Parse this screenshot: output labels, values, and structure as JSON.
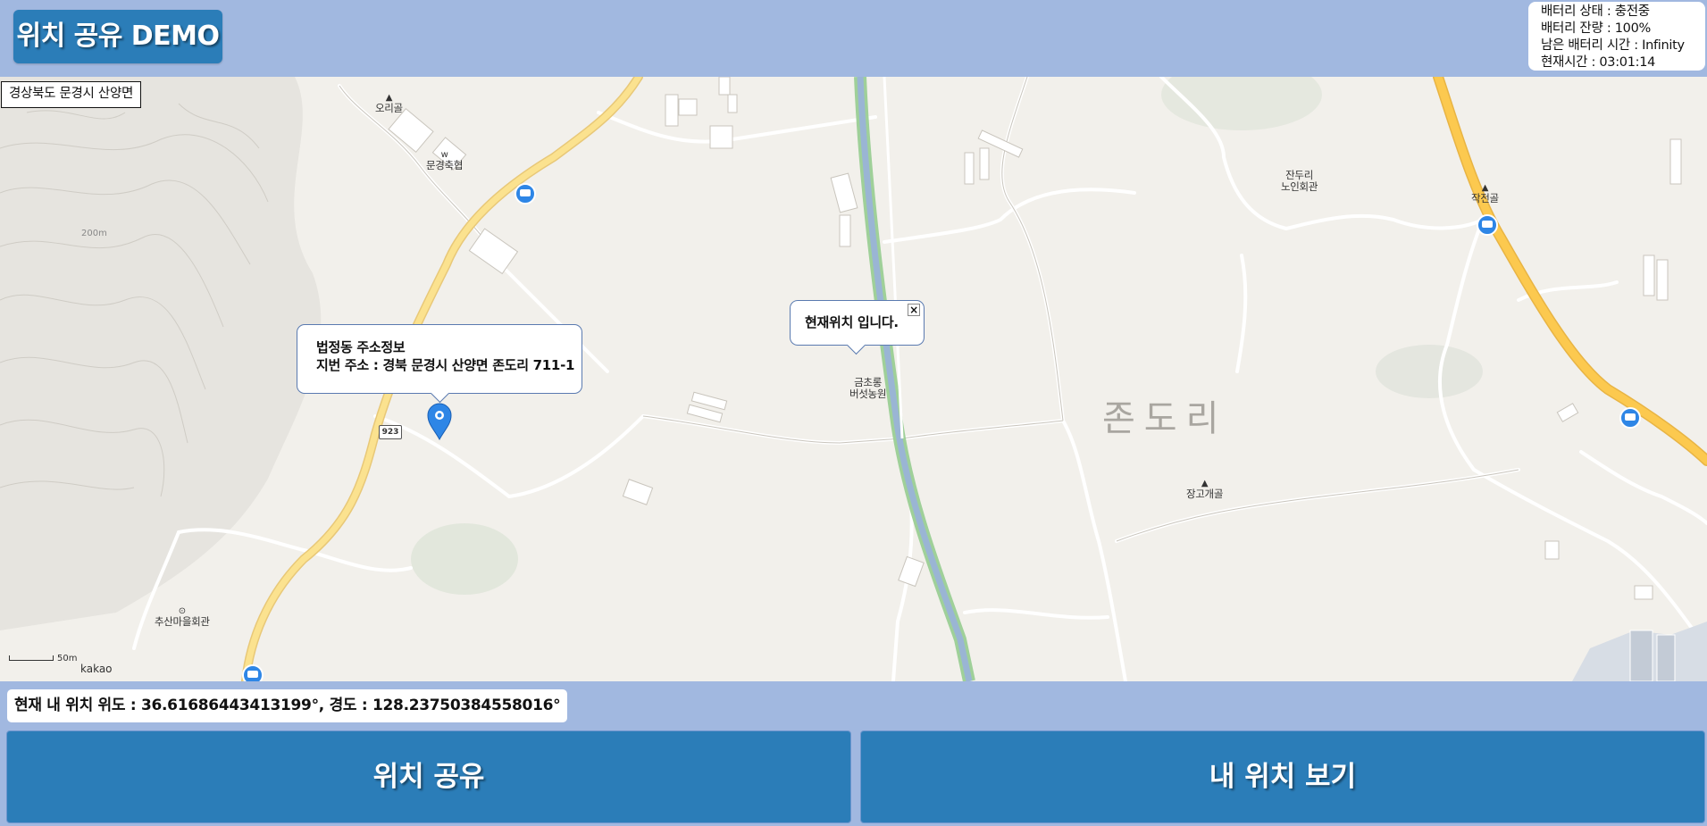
{
  "header": {
    "title": "위치 공유 DEMO"
  },
  "status": {
    "battery_state": "배터리 상태 : 충전중",
    "battery_level": "배터리 잔량 : 100%",
    "battery_time": "남은 배터리 시간 : Infinity",
    "current_time": "현재시간 : 03:01:14"
  },
  "map": {
    "region": "경상북도 문경시 산양면",
    "address_popup": {
      "title": "법정동 주소정보",
      "address": "지번 주소 : 경북 문경시 산양면 존도리 711-1"
    },
    "location_popup": {
      "text": "현재위치 입니다.",
      "close": "×"
    },
    "area_label": "존도리",
    "elevation": "200m",
    "road_number": "923",
    "pois": {
      "origol": "오리골",
      "chukhyup": "문경축협",
      "jandu_1": "잔두리",
      "jandu_2": "노인회관",
      "jakjeon": "작전골",
      "mushroom_1": "금초롱",
      "mushroom_2": "버섯농원",
      "janggo": "장고개골",
      "chusan": "추산마을회관"
    },
    "scale": "50m",
    "brand": "kakao"
  },
  "coords": "현재 내 위치 위도 : 36.61686443413199°, 경도 : 128.23750384558016°",
  "buttons": {
    "share": "위치 공유",
    "my_location": "내 위치 보기"
  },
  "colors": {
    "header_bg": "#a1b8e0",
    "button_bg": "#2b7db8",
    "marker": "#2e86e6"
  }
}
